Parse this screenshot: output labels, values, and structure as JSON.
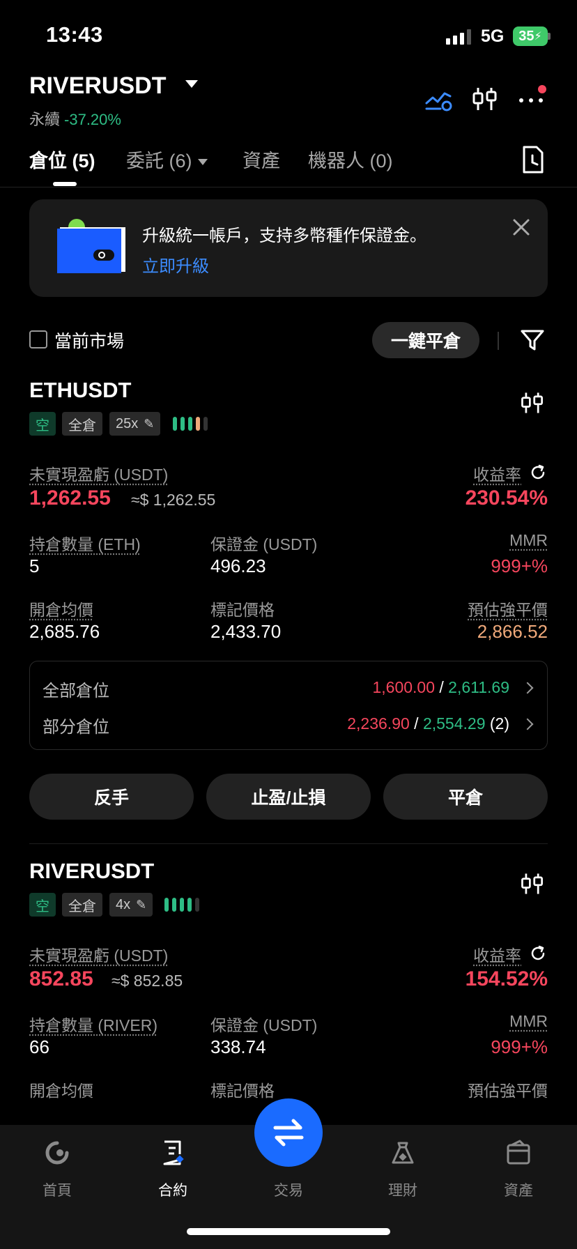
{
  "status_bar": {
    "time": "13:43",
    "network": "5G",
    "battery": "35"
  },
  "header": {
    "symbol": "RIVERUSDT",
    "contract_type": "永續",
    "change": "-37.20%"
  },
  "tabs": [
    {
      "label": "倉位 (5)",
      "active": true
    },
    {
      "label": "委託 (6)",
      "active": false
    },
    {
      "label": "資產",
      "active": false
    },
    {
      "label": "機器人 (0)",
      "active": false
    }
  ],
  "banner": {
    "text": "升級統一帳戶，支持多幣種作保證金。",
    "link": "立即升級"
  },
  "controls": {
    "current_market": "當前市場",
    "close_all": "一鍵平倉"
  },
  "positions": [
    {
      "symbol": "ETHUSDT",
      "tags": {
        "side": "空",
        "margin": "全倉",
        "leverage": "25x"
      },
      "labels": {
        "pnl": "未實現盈虧 (USDT)",
        "roe": "收益率",
        "qty": "持倉數量 (ETH)",
        "margin": "保證金 (USDT)",
        "mmr": "MMR",
        "entry": "開倉均價",
        "mark": "標記價格",
        "liq": "預估強平價"
      },
      "pnl": "1,262.55",
      "pnl_usd": "≈$ 1,262.55",
      "roe": "230.54%",
      "qty": "5",
      "margin": "496.23",
      "mmr": "999+%",
      "entry": "2,685.76",
      "mark": "2,433.70",
      "liq": "2,866.52"
    },
    {
      "symbol": "RIVERUSDT",
      "tags": {
        "side": "空",
        "margin": "全倉",
        "leverage": "4x"
      },
      "labels": {
        "pnl": "未實現盈虧 (USDT)",
        "roe": "收益率",
        "qty": "持倉數量 (RIVER)",
        "margin": "保證金 (USDT)",
        "mmr": "MMR",
        "entry": "開倉均價",
        "mark": "標記價格",
        "liq": "預估強平價"
      },
      "pnl": "852.85",
      "pnl_usd": "≈$ 852.85",
      "roe": "154.52%",
      "qty": "66",
      "margin": "338.74",
      "mmr": "999+%"
    }
  ],
  "tpsl_box": {
    "full": {
      "label": "全部倉位",
      "tp": "1,600.00",
      "sep": "/",
      "sl": "2,611.69"
    },
    "partial": {
      "label": "部分倉位",
      "tp": "2,236.90",
      "sep": "/",
      "sl": "2,554.29",
      "count": "(2)"
    }
  },
  "actions": {
    "reverse": "反手",
    "tpsl": "止盈/止損",
    "close": "平倉"
  },
  "bottom_nav": [
    {
      "label": "首頁",
      "icon": "home-icon"
    },
    {
      "label": "合約",
      "icon": "futures-icon",
      "active": true
    },
    {
      "label": "交易",
      "icon": "trade-swap-icon"
    },
    {
      "label": "理財",
      "icon": "earn-icon"
    },
    {
      "label": "資產",
      "icon": "wallet-icon"
    }
  ],
  "colors": {
    "up": "#2ebd85",
    "down": "#f6465d",
    "accent": "#1a6bff",
    "liq": "#f0a97a"
  }
}
